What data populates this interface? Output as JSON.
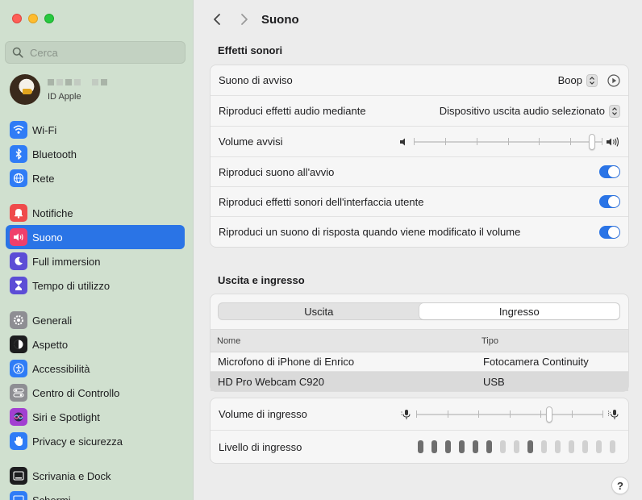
{
  "sidebar": {
    "search_placeholder": "Cerca",
    "account": {
      "subtitle": "ID Apple"
    },
    "groups": [
      [
        {
          "label": "Wi-Fi",
          "icon": "wifi-icon",
          "color": "#2f7cf6"
        },
        {
          "label": "Bluetooth",
          "icon": "bluetooth-icon",
          "color": "#2f7cf6"
        },
        {
          "label": "Rete",
          "icon": "globe-icon",
          "color": "#2f7cf6"
        }
      ],
      [
        {
          "label": "Notifiche",
          "icon": "bell-icon",
          "color": "#ef4b4b"
        },
        {
          "label": "Suono",
          "icon": "speaker-icon",
          "color": "#ef3f6b",
          "active": true
        },
        {
          "label": "Full immersion",
          "icon": "moon-icon",
          "color": "#5c4dd6"
        },
        {
          "label": "Tempo di utilizzo",
          "icon": "hourglass-icon",
          "color": "#5c4dd6"
        }
      ],
      [
        {
          "label": "Generali",
          "icon": "gear-icon",
          "color": "#8e8e93"
        },
        {
          "label": "Aspetto",
          "icon": "appearance-icon",
          "color": "#1d1d1f"
        },
        {
          "label": "Accessibilità",
          "icon": "accessibility-icon",
          "color": "#2f7cf6"
        },
        {
          "label": "Centro di Controllo",
          "icon": "control-center-icon",
          "color": "#8e8e93"
        },
        {
          "label": "Siri e Spotlight",
          "icon": "siri-icon",
          "color": "#a23fd1"
        },
        {
          "label": "Privacy e sicurezza",
          "icon": "hand-icon",
          "color": "#2f7cf6"
        }
      ],
      [
        {
          "label": "Scrivania e Dock",
          "icon": "dock-icon",
          "color": "#1d1d1f"
        },
        {
          "label": "Schermi",
          "icon": "display-icon",
          "color": "#2f7cf6"
        }
      ]
    ]
  },
  "toolbar": {
    "title": "Suono"
  },
  "sound_effects": {
    "title": "Effetti sonori",
    "alert_sound_label": "Suono di avviso",
    "alert_sound_value": "Boop",
    "play_effects_label": "Riproduci effetti audio mediante",
    "play_effects_value": "Dispositivo uscita audio selezionato",
    "alert_volume_label": "Volume avvisi",
    "alert_volume_level": 0.96,
    "startup_label": "Riproduci suono all'avvio",
    "startup_on": true,
    "ui_sounds_label": "Riproduci effetti sonori dell'interfaccia utente",
    "ui_sounds_on": true,
    "feedback_label": "Riproduci un suono di risposta quando viene modificato il volume",
    "feedback_on": true
  },
  "io": {
    "title": "Uscita e ingresso",
    "tabs": [
      "Uscita",
      "Ingresso"
    ],
    "selected_tab": "Ingresso",
    "columns": [
      "Nome",
      "Tipo"
    ],
    "rows": [
      {
        "name": "Microfono di iPhone di Enrico",
        "type": "Fotocamera Continuity",
        "selected": false
      },
      {
        "name": "HD Pro Webcam C920",
        "type": "USB",
        "selected": true
      }
    ],
    "input_volume_label": "Volume di ingresso",
    "input_volume_level": 0.72,
    "input_level_label": "Livello di ingresso",
    "input_level_bars": 15,
    "input_level_active": [
      1,
      1,
      1,
      1,
      1,
      1,
      0,
      0,
      1,
      0,
      0,
      0,
      0,
      0,
      0
    ]
  },
  "help": "?"
}
